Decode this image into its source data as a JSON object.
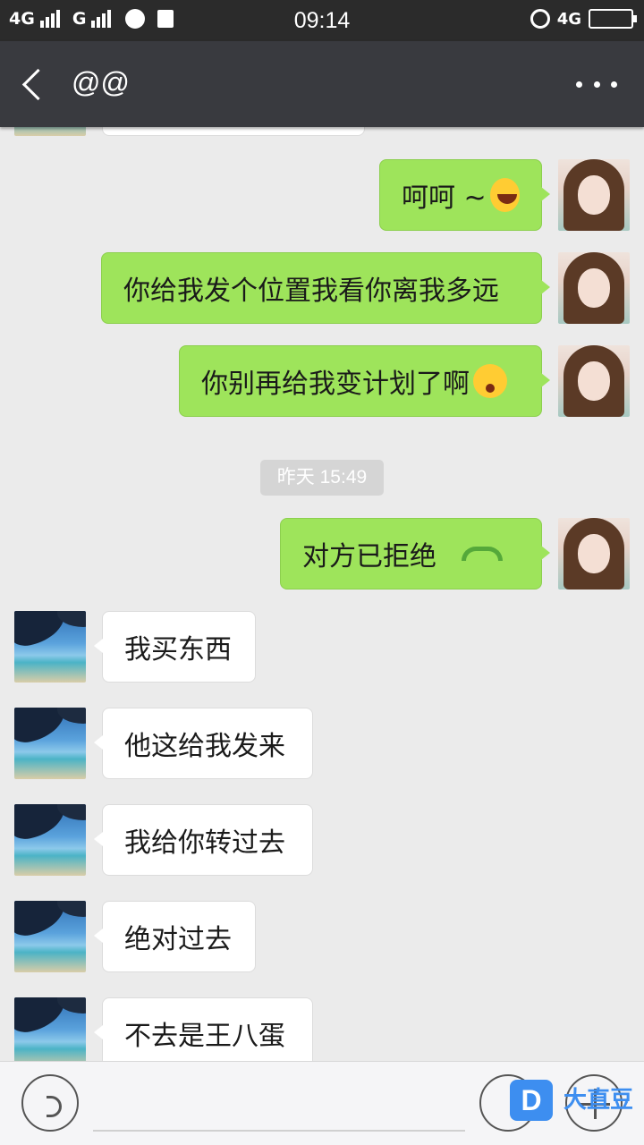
{
  "status_bar": {
    "network_left": "4G",
    "network_mid": "G",
    "time": "09:14",
    "network_right": "4G"
  },
  "header": {
    "title": "@@"
  },
  "messages": [
    {
      "from": "me",
      "text": "呵呵 ~",
      "emoji": "tears-of-joy-emoji"
    },
    {
      "from": "me",
      "text": "你给我发个位置我看你离我多远"
    },
    {
      "from": "me",
      "text": "你别再给我变计划了啊",
      "emoji": "shocked-emoji"
    },
    {
      "from": "me",
      "text": "对方已拒绝",
      "icon": "phone-hangup-icon"
    },
    {
      "from": "them",
      "text": "我买东西"
    },
    {
      "from": "them",
      "text": "他这给我发来"
    },
    {
      "from": "them",
      "text": "我给你转过去"
    },
    {
      "from": "them",
      "text": "绝对过去"
    },
    {
      "from": "them",
      "text": "不去是王八蛋"
    }
  ],
  "timestamp": "昨天 15:49",
  "watermark": {
    "logo": "D",
    "text": "大直豆"
  },
  "colors": {
    "my_bubble": "#9ee45b",
    "their_bubble": "#ffffff",
    "header_bg": "#393a3f",
    "chat_bg": "#ebebeb"
  }
}
